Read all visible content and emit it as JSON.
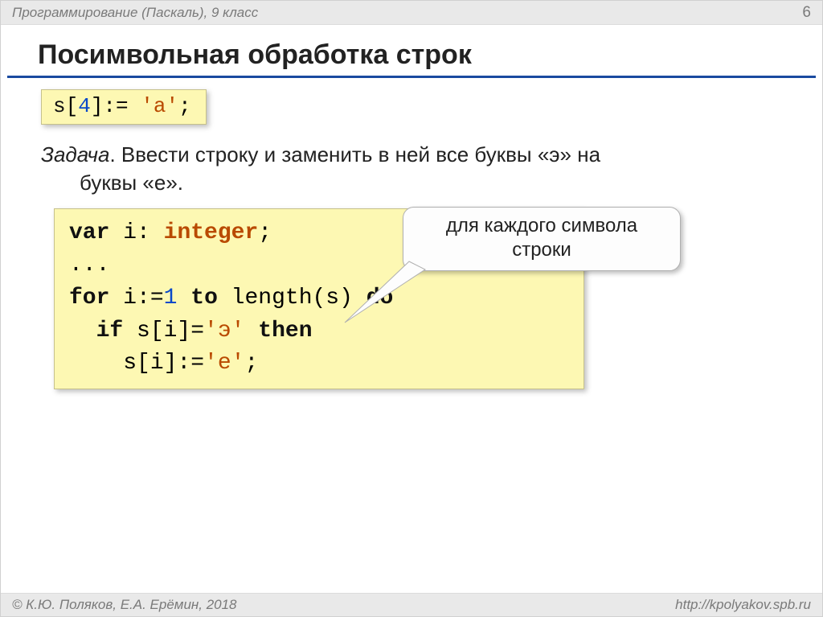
{
  "header": {
    "left": "Программирование (Паскаль), 9 класс",
    "page": "6"
  },
  "title": "Посимвольная обработка строк",
  "snippet1": {
    "s": "s",
    "lbr": "[",
    "idx": "4",
    "rbr_assign": "]:= ",
    "q1": "'",
    "ch": "а",
    "q2": "'",
    "semi": ";"
  },
  "task": {
    "label": "Задача",
    "dot": ". ",
    "line1": "Ввести строку и заменить в ней все буквы «э» на",
    "line2": "буквы «е»."
  },
  "callout": {
    "line1": "для каждого символа",
    "line2": "строки"
  },
  "code": {
    "l1_var": "var",
    "l1_sp1": " i: ",
    "l1_type": "integer",
    "l1_semi": ";",
    "l2": "...",
    "l3_for": "for",
    "l3_a": " i:=",
    "l3_one": "1",
    "l3_b": " ",
    "l3_to": "to",
    "l3_c": " length(s) ",
    "l3_do": "do",
    "l4_pad": "  ",
    "l4_if": "if",
    "l4_a": " s[i]=",
    "l4_q1": "'",
    "l4_ch": "э",
    "l4_q2": "'",
    "l4_sp": " ",
    "l4_then": "then",
    "l5_pad": "    s[i]:=",
    "l5_q1": "'",
    "l5_ch": "е",
    "l5_q2": "'",
    "l5_semi": ";"
  },
  "footer": {
    "left": "© К.Ю. Поляков, Е.А. Ерёмин, 2018",
    "right": "http://kpolyakov.spb.ru"
  }
}
